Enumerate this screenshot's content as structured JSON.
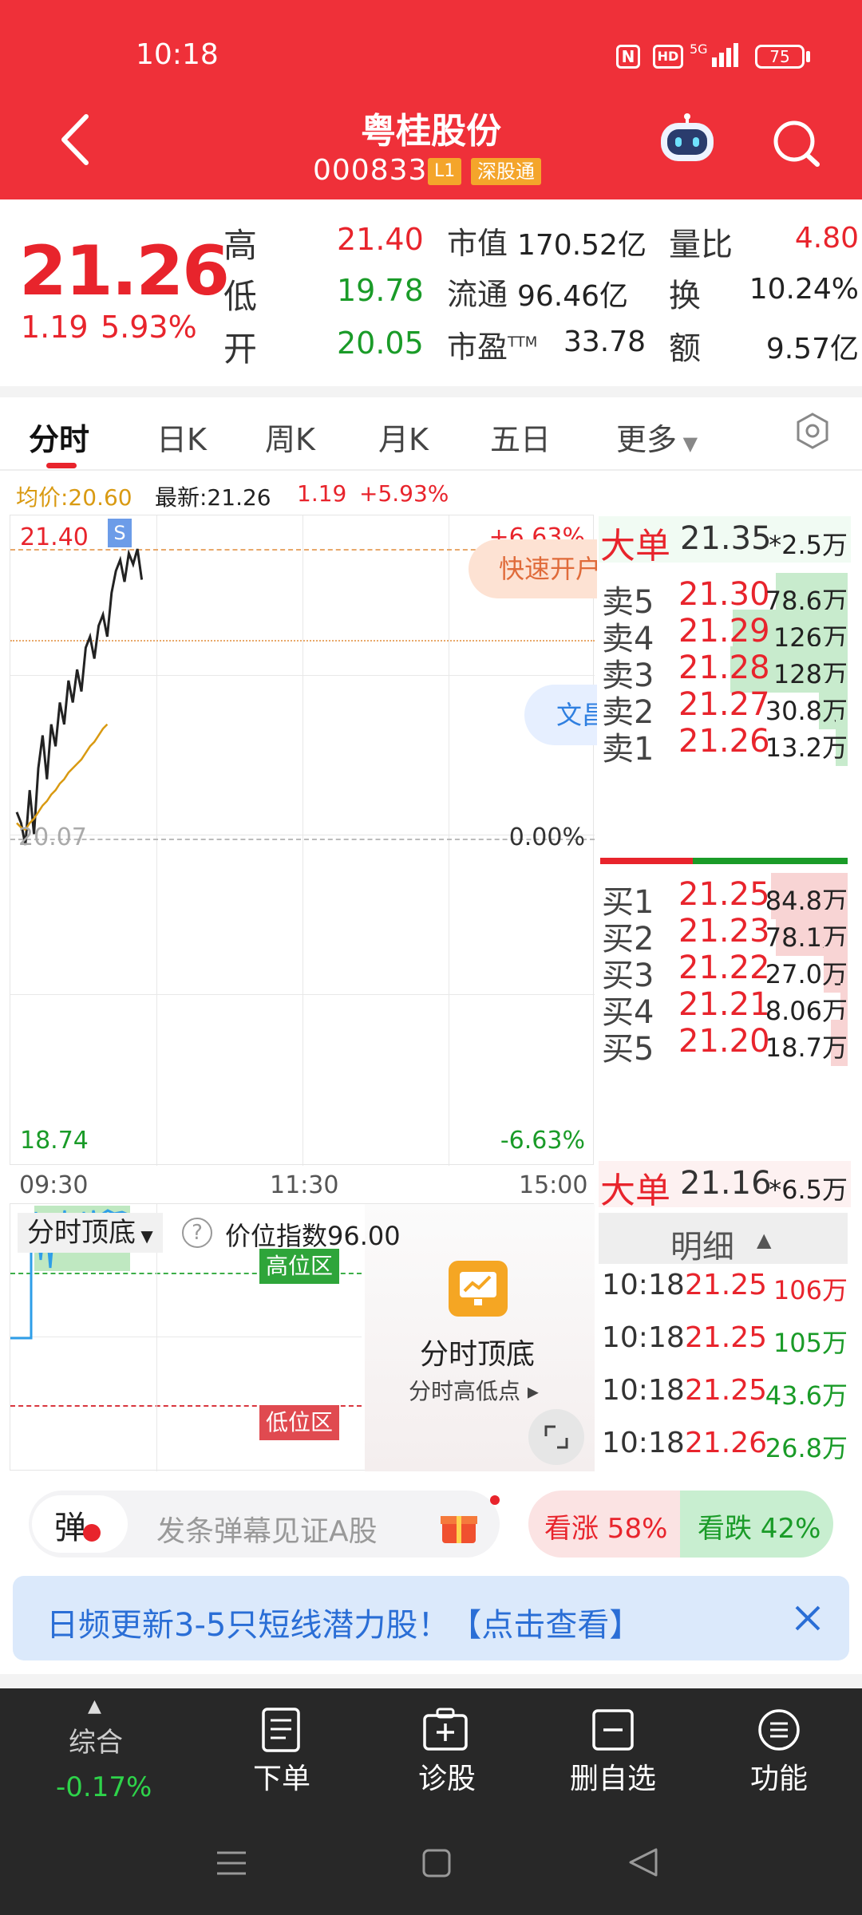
{
  "status_bar": {
    "time": "10:18",
    "battery": "75",
    "network": "5G",
    "hd": "HD"
  },
  "header": {
    "title": "粤桂股份",
    "code": "000833",
    "tag_level": "L1",
    "tag_exchange": "深股通"
  },
  "quote": {
    "price": "21.26",
    "change": "1.19",
    "change_pct": "5.93%",
    "high_label": "高",
    "high": "21.40",
    "low_label": "低",
    "low": "19.78",
    "open_label": "开",
    "open": "20.05",
    "mktcap_label": "市值",
    "mktcap": "170.52亿",
    "float_label": "流通",
    "float": "96.46亿",
    "pe_label": "市盈TTM",
    "pe": "33.78",
    "vol_ratio_label": "量比",
    "vol_ratio": "4.80",
    "turnover_label": "换",
    "turnover": "10.24%",
    "amount_label": "额",
    "amount": "9.57亿"
  },
  "tabs": [
    "分时",
    "日K",
    "周K",
    "月K",
    "五日",
    "更多"
  ],
  "info_line": {
    "avg_label": "均价:20.60",
    "latest_label": "最新:21.26",
    "change": "1.19",
    "change_pct": "+5.93%"
  },
  "chart": {
    "high_price": "21.40",
    "high_pct": "+6.63%",
    "base_price": "20.07",
    "base_pct": "0.00%",
    "low_price": "18.74",
    "low_pct": "-6.63%",
    "time_start": "09:30",
    "time_mid": "11:30",
    "time_end": "15:00",
    "marker": "S",
    "quick_open": "快速开户",
    "wen": "文昌"
  },
  "chart_data": {
    "type": "line",
    "series": [
      {
        "values": [
          20.2,
          20.15,
          20.05,
          20.3,
          20.1,
          20.4,
          20.55,
          20.35,
          20.6,
          20.5,
          20.7,
          20.6,
          20.8,
          20.7,
          20.85,
          20.75,
          20.95,
          21.0,
          20.9,
          21.05,
          21.1,
          21.0,
          21.2,
          21.3,
          21.35,
          21.25,
          21.38,
          21.33,
          21.4,
          21.26
        ]
      },
      {
        "values": [
          20.15,
          20.13,
          20.12,
          20.15,
          20.17,
          20.2,
          20.23,
          20.25,
          20.28,
          20.3,
          20.33,
          20.35,
          20.38,
          20.4,
          20.42,
          20.44,
          20.47,
          20.5,
          20.52,
          20.55,
          20.58,
          20.6
        ]
      }
    ],
    "ylim": [
      18.74,
      21.4
    ]
  },
  "order_book": {
    "big_sell_label": "大单",
    "big_sell_price": "21.35",
    "big_sell_vol": "*2.5万",
    "asks": [
      {
        "label": "卖5",
        "price": "21.30",
        "vol": "78.6万",
        "pct": 0.3
      },
      {
        "label": "卖4",
        "price": "21.29",
        "vol": "126万",
        "pct": 0.48
      },
      {
        "label": "卖3",
        "price": "21.28",
        "vol": "128万",
        "pct": 0.49
      },
      {
        "label": "卖2",
        "price": "21.27",
        "vol": "30.8万",
        "pct": 0.12
      },
      {
        "label": "卖1",
        "price": "21.26",
        "vol": "13.2万",
        "pct": 0.05
      }
    ],
    "bids": [
      {
        "label": "买1",
        "price": "21.25",
        "vol": "84.8万",
        "pct": 0.32
      },
      {
        "label": "买2",
        "price": "21.23",
        "vol": "78.1万",
        "pct": 0.3
      },
      {
        "label": "买3",
        "price": "21.22",
        "vol": "27.0万",
        "pct": 0.1
      },
      {
        "label": "买4",
        "price": "21.21",
        "vol": "8.06万",
        "pct": 0.03
      },
      {
        "label": "买5",
        "price": "21.20",
        "vol": "18.7万",
        "pct": 0.07
      }
    ],
    "big_buy_label": "大单",
    "big_buy_price": "21.16",
    "big_buy_vol": "*6.5万",
    "detail_title": "明细",
    "details": [
      {
        "time": "10:18",
        "price": "21.25",
        "vol": "106万",
        "color": "red"
      },
      {
        "time": "10:18",
        "price": "21.25",
        "vol": "105万",
        "color": "green"
      },
      {
        "time": "10:18",
        "price": "21.25",
        "vol": "43.6万",
        "color": "green"
      },
      {
        "time": "10:18",
        "price": "21.26",
        "vol": "26.8万",
        "color": "green"
      }
    ]
  },
  "indicator": {
    "name": "分时顶底",
    "value_label": "价位指数96.00",
    "high_zone": "高位区",
    "low_zone": "低位区",
    "promo_title": "分时顶底",
    "promo_sub": "分时高低点"
  },
  "danmu": {
    "badge": "弹",
    "placeholder": "发条弹幕见证A股",
    "rise": "看涨 58%",
    "fall": "看跌 42%"
  },
  "banner": {
    "text": "日频更新3-5只短线潜力股！【点击查看】"
  },
  "bottom_nav": {
    "index_label": "综合",
    "index_value": "-0.17%",
    "items": [
      "下单",
      "诊股",
      "删自选",
      "功能"
    ]
  },
  "colors": {
    "brand": "#ef3039",
    "up": "#e8242c",
    "down": "#1a9b28",
    "avg": "#d99a12"
  }
}
